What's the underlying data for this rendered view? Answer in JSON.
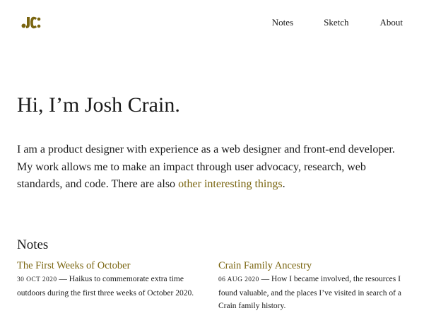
{
  "brand": {
    "logo_text": "JC",
    "color": "#7a6510"
  },
  "nav": {
    "items": [
      {
        "label": "Notes"
      },
      {
        "label": "Sketch"
      },
      {
        "label": "About"
      }
    ]
  },
  "hero": {
    "title": "Hi, I’m Josh Crain.",
    "intro_text": "I am a product designer with experience as a web designer and front-end developer. My work allows me to make an impact through user advocacy, research, web standards, and code. There are also ",
    "intro_link": "other interesting things",
    "intro_end": "."
  },
  "notes": {
    "heading": "Notes",
    "items": [
      {
        "title": "The First Weeks of October",
        "date": "30 OCT 2020",
        "summary": " — Haikus to commemorate extra time outdoors during the first three weeks of October 2020."
      },
      {
        "title": "Crain Family Ancestry",
        "date": "06 AUG 2020",
        "summary": " — How I became involved, the resources I found valuable, and the places I’ve visited in search of a Crain family history."
      }
    ]
  },
  "colors": {
    "accent": "#7a6510",
    "text": "#1a1a1a",
    "background": "#ffffff"
  }
}
